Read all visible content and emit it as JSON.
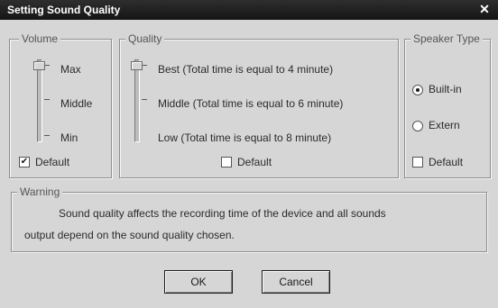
{
  "window": {
    "title": "Setting Sound Quality",
    "close_glyph": "✕"
  },
  "volume": {
    "legend": "Volume",
    "max_label": "Max",
    "middle_label": "Middle",
    "min_label": "Min",
    "default_label": "Default",
    "default_checked": true,
    "level": 1.0
  },
  "quality": {
    "legend": "Quality",
    "best_label": "Best (Total time is equal to 4 minute)",
    "middle_label": "Middle (Total time is equal to 6 minute)",
    "low_label": "Low (Total time is equal to 8 minute)",
    "default_label": "Default",
    "default_checked": false,
    "level": 0.0
  },
  "speaker": {
    "legend": "Speaker Type",
    "options": [
      "Built-in",
      "Extern"
    ],
    "selected": "Built-in",
    "default_label": "Default",
    "default_checked": false
  },
  "warning": {
    "legend": "Warning",
    "line1": "Sound quality affects the recording time of the device and all sounds",
    "line2": "output depend on the sound quality chosen."
  },
  "buttons": {
    "ok_label": "OK",
    "cancel_label": "Cancel"
  },
  "icons": {
    "check": "✔",
    "close": "close-icon",
    "radio_dot": "radio-dot-icon"
  },
  "colors": {
    "titlebar": "#222222",
    "dialog": "#d6d6d6"
  }
}
